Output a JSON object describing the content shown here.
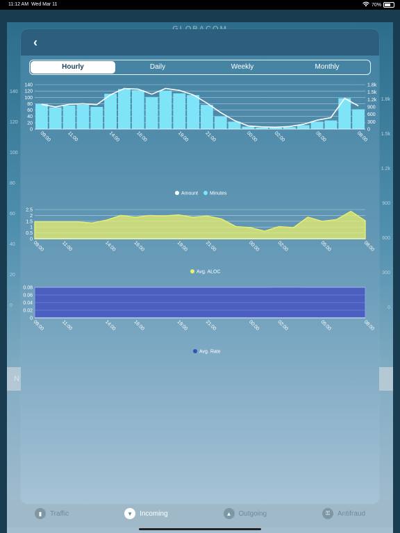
{
  "status": {
    "time": "11:12 AM",
    "date": "Wed Mar 11",
    "battery": "70%",
    "battery_level": 0.7
  },
  "background": {
    "title": "GLOBACOM",
    "left_axis": [
      "140",
      "120",
      "100",
      "80",
      "60",
      "40",
      "20",
      "0"
    ],
    "right_axis": [
      "1.8k",
      "1.5k",
      "1.2k",
      "900",
      "600",
      "300",
      "0"
    ],
    "section_letter": "N"
  },
  "tabbar": [
    {
      "label": "Traffic",
      "icon": "bar-chart-icon",
      "active": false
    },
    {
      "label": "Incoming",
      "icon": "arrow-down-circle-icon",
      "active": true
    },
    {
      "label": "Outgoing",
      "icon": "arrow-up-circle-icon",
      "active": false
    },
    {
      "label": "Antifraud",
      "icon": "lock-icon",
      "active": false
    }
  ],
  "modal": {
    "back_icon": "chevron-left-icon",
    "segments": [
      "Hourly",
      "Daily",
      "Weekly",
      "Monthly"
    ],
    "selected_segment": "Hourly"
  },
  "colors": {
    "bars": "#7fe4f7",
    "line_white": "#ffffff",
    "aloc": "#e8ef6e",
    "rate": "#3a4fb5"
  },
  "chart_data": [
    {
      "type": "bar",
      "x": [
        "09:00",
        "10:00",
        "11:00",
        "12:00",
        "13:00",
        "14:00",
        "15:00",
        "16:00",
        "17:00",
        "18:00",
        "19:00",
        "20:00",
        "21:00",
        "22:00",
        "23:00",
        "00:00",
        "01:00",
        "02:00",
        "03:00",
        "04:00",
        "05:00",
        "06:00",
        "07:00",
        "08:00"
      ],
      "x_tick_labels": [
        "09:00",
        "11:00",
        "14:00",
        "16:00",
        "19:00",
        "21:00",
        "00:00",
        "02:00",
        "05:00",
        "08:00"
      ],
      "series": [
        {
          "name": "Minutes",
          "axis": "right",
          "values": [
            1020,
            880,
            960,
            990,
            900,
            1430,
            1620,
            1580,
            1300,
            1560,
            1450,
            1380,
            980,
            520,
            300,
            100,
            60,
            60,
            80,
            160,
            300,
            350,
            1250,
            800
          ]
        },
        {
          "name": "Amount",
          "axis": "left",
          "values": [
            78,
            70,
            78,
            80,
            77,
            108,
            128,
            126,
            110,
            128,
            122,
            108,
            82,
            52,
            27,
            10,
            7,
            6,
            8,
            15,
            28,
            36,
            97,
            73
          ]
        }
      ],
      "y_left_ticks": [
        "140",
        "120",
        "100",
        "80",
        "60",
        "40",
        "20",
        "0"
      ],
      "y_right_ticks": [
        "1.8k",
        "1.5k",
        "1.2k",
        "900",
        "600",
        "300",
        "0"
      ],
      "ylim_left": [
        0,
        140
      ],
      "ylim_right": [
        0,
        1800
      ],
      "legend": [
        "Amount",
        "Minutes"
      ]
    },
    {
      "type": "area",
      "x": [
        "09:00",
        "10:00",
        "11:00",
        "12:00",
        "13:00",
        "14:00",
        "15:00",
        "16:00",
        "17:00",
        "18:00",
        "19:00",
        "20:00",
        "21:00",
        "22:00",
        "23:00",
        "00:00",
        "01:00",
        "02:00",
        "03:00",
        "04:00",
        "05:00",
        "06:00",
        "07:00",
        "08:00"
      ],
      "x_tick_labels": [
        "09:00",
        "11:00",
        "14:00",
        "16:00",
        "19:00",
        "21:00",
        "00:00",
        "02:00",
        "05:00",
        "08:00"
      ],
      "series": [
        {
          "name": "Avg. ALOC",
          "values": [
            1.45,
            1.45,
            1.45,
            1.45,
            1.35,
            1.6,
            2.0,
            1.85,
            2.0,
            1.95,
            2.05,
            1.85,
            1.95,
            1.7,
            1.05,
            0.95,
            0.65,
            1.05,
            0.95,
            1.85,
            1.5,
            1.65,
            2.35,
            1.55
          ]
        }
      ],
      "y_ticks": [
        "2.5",
        "2",
        "1.5",
        "1",
        "0.5",
        "0"
      ],
      "ylim": [
        0,
        2.5
      ],
      "legend": [
        "Avg. ALOC"
      ]
    },
    {
      "type": "area",
      "x": [
        "09:00",
        "10:00",
        "11:00",
        "12:00",
        "13:00",
        "14:00",
        "15:00",
        "16:00",
        "17:00",
        "18:00",
        "19:00",
        "20:00",
        "21:00",
        "22:00",
        "23:00",
        "00:00",
        "01:00",
        "02:00",
        "03:00",
        "04:00",
        "05:00",
        "06:00",
        "07:00",
        "08:00"
      ],
      "x_tick_labels": [
        "09:00",
        "11:00",
        "14:00",
        "16:00",
        "19:00",
        "21:00",
        "00:00",
        "02:00",
        "05:00",
        "08:00"
      ],
      "series": [
        {
          "name": "Avg. Rate",
          "values": [
            0.08,
            0.08,
            0.08,
            0.08,
            0.08,
            0.08,
            0.08,
            0.08,
            0.08,
            0.08,
            0.08,
            0.08,
            0.08,
            0.08,
            0.08,
            0.08,
            0.08,
            0.0805,
            0.0805,
            0.08,
            0.08,
            0.08,
            0.08,
            0.08
          ]
        }
      ],
      "y_ticks": [
        "0.08",
        "0.06",
        "0.04",
        "0.02",
        "0"
      ],
      "ylim": [
        0,
        0.08
      ],
      "legend": [
        "Avg. Rate"
      ]
    }
  ]
}
